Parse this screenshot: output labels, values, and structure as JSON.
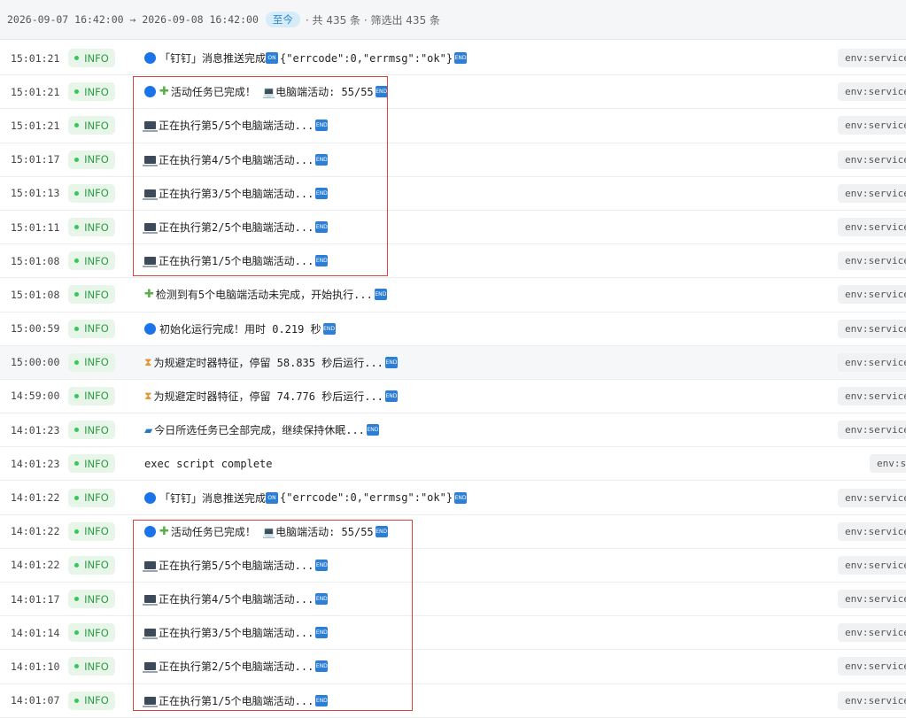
{
  "filter": {
    "range": "2026-09-07 16:42:00 → 2026-09-08 16:42:00",
    "until_label": "至今",
    "summary": "· 共 435 条 · 筛选出 435 条"
  },
  "level_label": "INFO",
  "rows": [
    {
      "time": "15:01:21",
      "icon": "blue-circle",
      "text": "「钉钉」消息推送完成 ",
      "ding": true,
      "tail": "{\"errcode\":0,\"errmsg\":\"ok\"}",
      "end": true,
      "env": "env:service_"
    },
    {
      "time": "15:01:21",
      "icon": "blue-circle-puzzle",
      "text": "活动任务已完成！ 💻电脑端活动: 55/55",
      "end": true,
      "env": "env:service_"
    },
    {
      "time": "15:01:21",
      "icon": "laptop",
      "text": "正在执行第5/5个电脑端活动...",
      "end": true,
      "env": "env:service_"
    },
    {
      "time": "15:01:17",
      "icon": "laptop",
      "text": "正在执行第4/5个电脑端活动...",
      "end": true,
      "env": "env:service_"
    },
    {
      "time": "15:01:13",
      "icon": "laptop",
      "text": "正在执行第3/5个电脑端活动...",
      "end": true,
      "env": "env:service_"
    },
    {
      "time": "15:01:11",
      "icon": "laptop",
      "text": "正在执行第2/5个电脑端活动...",
      "end": true,
      "env": "env:service_"
    },
    {
      "time": "15:01:08",
      "icon": "laptop",
      "text": "正在执行第1/5个电脑端活动...",
      "end": true,
      "env": "env:service_"
    },
    {
      "time": "15:01:08",
      "icon": "puzzle",
      "text": "检测到有5个电脑端活动未完成，开始执行...",
      "end": true,
      "env": "env:service_"
    },
    {
      "time": "15:00:59",
      "icon": "blue-circle",
      "text": "初始化运行完成！用时 0.219 秒",
      "end": true,
      "env": "env:service_"
    },
    {
      "time": "15:00:00",
      "icon": "hourglass",
      "text": "为规避定时器特征，停留 58.835 秒后运行...",
      "end": true,
      "env": "env:service_",
      "highlight": true
    },
    {
      "time": "14:59:00",
      "icon": "hourglass",
      "text": "为规避定时器特征，停留 74.776 秒后运行...",
      "end": true,
      "env": "env:service_"
    },
    {
      "time": "14:01:23",
      "icon": "sleep",
      "text": "今日所选任务已全部完成，继续保持休眠...",
      "end": true,
      "env": "env:service_"
    },
    {
      "time": "14:01:23",
      "icon": "",
      "text": "exec script complete",
      "end": false,
      "env": "env:sa",
      "env_short": true
    },
    {
      "time": "14:01:22",
      "icon": "blue-circle",
      "text": "「钉钉」消息推送完成 ",
      "ding": true,
      "tail": "{\"errcode\":0,\"errmsg\":\"ok\"}",
      "end": true,
      "env": "env:service_"
    },
    {
      "time": "14:01:22",
      "icon": "blue-circle-puzzle",
      "text": "活动任务已完成！ 💻电脑端活动: 55/55",
      "end": true,
      "env": "env:service_"
    },
    {
      "time": "14:01:22",
      "icon": "laptop",
      "text": "正在执行第5/5个电脑端活动...",
      "end": true,
      "env": "env:service_"
    },
    {
      "time": "14:01:17",
      "icon": "laptop",
      "text": "正在执行第4/5个电脑端活动...",
      "end": true,
      "env": "env:service_"
    },
    {
      "time": "14:01:14",
      "icon": "laptop",
      "text": "正在执行第3/5个电脑端活动...",
      "end": true,
      "env": "env:service_"
    },
    {
      "time": "14:01:10",
      "icon": "laptop",
      "text": "正在执行第2/5个电脑端活动...",
      "end": true,
      "env": "env:service_"
    },
    {
      "time": "14:01:07",
      "icon": "laptop",
      "text": "正在执行第1/5个电脑端活动...",
      "end": true,
      "env": "env:service_"
    }
  ],
  "colors": {
    "highlight_box": "#d9453d",
    "info_badge_bg": "#e8f6ea",
    "info_badge_text": "#2f9b45"
  }
}
